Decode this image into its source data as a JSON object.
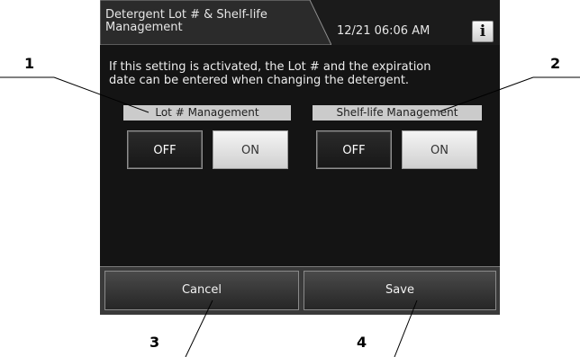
{
  "header": {
    "title": "Detergent Lot # & Shelf-life\nManagement",
    "clock": "12/21 06:06 AM",
    "info_icon": "i"
  },
  "description": "If this setting is activated, the Lot # and the expiration\ndate can be entered when changing the detergent.",
  "settings": [
    {
      "label": "Lot # Management",
      "off_label": "OFF",
      "on_label": "ON",
      "selected": "ON"
    },
    {
      "label": "Shelf-life Management",
      "off_label": "OFF",
      "on_label": "ON",
      "selected": "ON"
    }
  ],
  "footer": {
    "cancel_label": "Cancel",
    "save_label": "Save"
  },
  "callouts": [
    "1",
    "2",
    "3",
    "4"
  ],
  "icons": {
    "info": "info-icon"
  },
  "colors": {
    "screen": "#1b1b1b",
    "button_selected": "#e6e6e6",
    "button_unselected": "#1f1f1f"
  }
}
